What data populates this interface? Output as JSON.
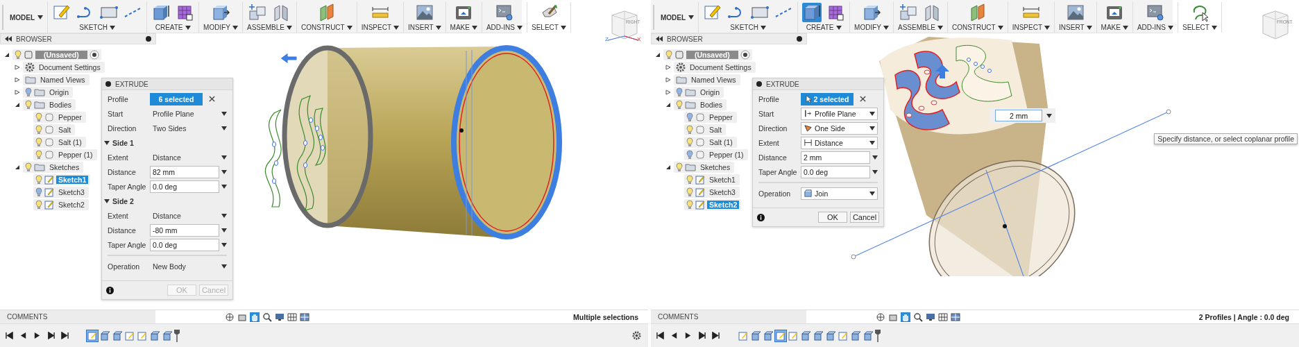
{
  "panes": [
    {
      "toolbar": {
        "workspace": "MODEL",
        "groups": [
          {
            "label": "SKETCH",
            "selected": false
          },
          {
            "label": "CREATE",
            "selected": false
          },
          {
            "label": "MODIFY",
            "selected": false
          },
          {
            "label": "ASSEMBLE",
            "selected": false
          },
          {
            "label": "CONSTRUCT",
            "selected": false
          },
          {
            "label": "INSPECT",
            "selected": false
          },
          {
            "label": "INSERT",
            "selected": false
          },
          {
            "label": "MAKE",
            "selected": false
          },
          {
            "label": "ADD-INS",
            "selected": false
          },
          {
            "label": "SELECT",
            "selected": false
          }
        ]
      },
      "view_cube": {
        "face": "RIGHT",
        "axes": [
          "Z",
          "X"
        ]
      },
      "browser": {
        "title": "BROWSER",
        "tree": [
          {
            "label": "(Unsaved)",
            "kind": "component",
            "expanded": true,
            "visible": true,
            "selected": false,
            "children": [
              {
                "label": "Document Settings",
                "kind": "settings",
                "expanded": false,
                "selected": false
              },
              {
                "label": "Named Views",
                "kind": "folder",
                "expanded": false,
                "selected": false
              },
              {
                "label": "Origin",
                "kind": "folder",
                "expanded": false,
                "visible": false,
                "selected": false
              },
              {
                "label": "Bodies",
                "kind": "folder",
                "expanded": true,
                "visible": true,
                "selected": false,
                "children": [
                  {
                    "label": "Pepper",
                    "kind": "body",
                    "visible": true,
                    "selected": false
                  },
                  {
                    "label": "Salt",
                    "kind": "body",
                    "visible": true,
                    "selected": false
                  },
                  {
                    "label": "Salt (1)",
                    "kind": "body",
                    "visible": true,
                    "selected": false
                  },
                  {
                    "label": "Pepper (1)",
                    "kind": "body",
                    "visible": true,
                    "selected": false
                  }
                ]
              },
              {
                "label": "Sketches",
                "kind": "folder",
                "expanded": true,
                "visible": true,
                "selected": false,
                "children": [
                  {
                    "label": "Sketch1",
                    "kind": "sketch",
                    "visible": true,
                    "selected": true
                  },
                  {
                    "label": "Sketch3",
                    "kind": "sketch",
                    "visible": false,
                    "selected": false
                  },
                  {
                    "label": "Sketch2",
                    "kind": "sketch",
                    "visible": true,
                    "selected": false
                  }
                ]
              }
            ]
          }
        ]
      },
      "dialog": {
        "title": "EXTRUDE",
        "rows": [
          {
            "kind": "selection",
            "label": "Profile",
            "value": "6 selected",
            "picking": false
          },
          {
            "kind": "menu",
            "label": "Start",
            "value": "Profile Plane"
          },
          {
            "kind": "menu",
            "label": "Direction",
            "value": "Two Sides"
          },
          {
            "kind": "section",
            "label": "Side 1",
            "expanded": true
          },
          {
            "kind": "menu",
            "label": "Extent",
            "value": "Distance"
          },
          {
            "kind": "field",
            "label": "Distance",
            "value": "82 mm"
          },
          {
            "kind": "field",
            "label": "Taper Angle",
            "value": "0.0 deg"
          },
          {
            "kind": "section",
            "label": "Side 2",
            "expanded": true
          },
          {
            "kind": "menu",
            "label": "Extent",
            "value": "Distance"
          },
          {
            "kind": "field",
            "label": "Distance",
            "value": "-80 mm"
          },
          {
            "kind": "field",
            "label": "Taper Angle",
            "value": "0.0 deg"
          },
          {
            "kind": "divider"
          },
          {
            "kind": "menu",
            "label": "Operation",
            "value": "New Body"
          }
        ],
        "buttons": [
          {
            "label": "OK",
            "disabled": true
          },
          {
            "label": "Cancel",
            "disabled": true
          }
        ]
      },
      "comments": {
        "title": "COMMENTS"
      },
      "status": "Multiple selections",
      "timeline": [
        {
          "kind": "sketch",
          "selected": true
        },
        {
          "kind": "extrude",
          "selected": false
        },
        {
          "kind": "extrude",
          "selected": false
        },
        {
          "kind": "sketch",
          "selected": false
        },
        {
          "kind": "sketch",
          "selected": false
        },
        {
          "kind": "extrude",
          "selected": false
        },
        {
          "kind": "extrude",
          "selected": false
        }
      ]
    },
    {
      "toolbar": {
        "workspace": "MODEL",
        "groups": [
          {
            "label": "SKETCH",
            "selected": false
          },
          {
            "label": "CREATE",
            "selected": true
          },
          {
            "label": "MODIFY",
            "selected": false
          },
          {
            "label": "ASSEMBLE",
            "selected": false
          },
          {
            "label": "CONSTRUCT",
            "selected": false
          },
          {
            "label": "INSPECT",
            "selected": false
          },
          {
            "label": "INSERT",
            "selected": false
          },
          {
            "label": "MAKE",
            "selected": false
          },
          {
            "label": "ADD-INS",
            "selected": false
          },
          {
            "label": "SELECT",
            "selected": false
          }
        ]
      },
      "view_cube": {
        "face": "FRONT"
      },
      "browser": {
        "title": "BROWSER",
        "tree": [
          {
            "label": "(Unsaved)",
            "kind": "component",
            "expanded": true,
            "visible": true,
            "selected": false,
            "children": [
              {
                "label": "Document Settings",
                "kind": "settings",
                "expanded": false,
                "selected": false
              },
              {
                "label": "Named Views",
                "kind": "folder",
                "expanded": false,
                "selected": false
              },
              {
                "label": "Origin",
                "kind": "folder",
                "expanded": false,
                "visible": false,
                "selected": false
              },
              {
                "label": "Bodies",
                "kind": "folder",
                "expanded": true,
                "visible": true,
                "selected": false,
                "children": [
                  {
                    "label": "Pepper",
                    "kind": "body",
                    "visible": false,
                    "selected": false
                  },
                  {
                    "label": "Salt",
                    "kind": "body",
                    "visible": true,
                    "selected": false
                  },
                  {
                    "label": "Salt (1)",
                    "kind": "body",
                    "visible": true,
                    "selected": false
                  },
                  {
                    "label": "Pepper (1)",
                    "kind": "body",
                    "visible": false,
                    "selected": false
                  }
                ]
              },
              {
                "label": "Sketches",
                "kind": "folder",
                "expanded": true,
                "visible": true,
                "selected": false,
                "children": [
                  {
                    "label": "Sketch1",
                    "kind": "sketch",
                    "visible": true,
                    "selected": false
                  },
                  {
                    "label": "Sketch3",
                    "kind": "sketch",
                    "visible": true,
                    "selected": false
                  },
                  {
                    "label": "Sketch2",
                    "kind": "sketch",
                    "visible": true,
                    "selected": true
                  }
                ]
              }
            ]
          }
        ]
      },
      "dialog": {
        "title": "EXTRUDE",
        "rows": [
          {
            "kind": "selection",
            "label": "Profile",
            "value": "2 selected",
            "picking": true
          },
          {
            "kind": "select",
            "label": "Start",
            "value": "Profile Plane"
          },
          {
            "kind": "select",
            "label": "Direction",
            "value": "One Side"
          },
          {
            "kind": "select",
            "label": "Extent",
            "value": "Distance"
          },
          {
            "kind": "field",
            "label": "Distance",
            "value": "2 mm"
          },
          {
            "kind": "field",
            "label": "Taper Angle",
            "value": "0.0 deg"
          },
          {
            "kind": "divider"
          },
          {
            "kind": "select",
            "label": "Operation",
            "value": "Join"
          }
        ],
        "buttons": [
          {
            "label": "OK",
            "disabled": false
          },
          {
            "label": "Cancel",
            "disabled": false
          }
        ]
      },
      "viewport": {
        "distance_input": "2 mm",
        "tooltip": "Specify distance, or select coplanar profile"
      },
      "comments": {
        "title": "COMMENTS"
      },
      "status": "2 Profiles | Angle : 0.0 deg",
      "timeline": [
        {
          "kind": "sketch",
          "selected": false
        },
        {
          "kind": "extrude",
          "selected": false
        },
        {
          "kind": "extrude",
          "selected": false
        },
        {
          "kind": "sketch",
          "selected": true
        },
        {
          "kind": "sketch",
          "selected": false
        },
        {
          "kind": "extrude",
          "selected": false
        },
        {
          "kind": "extrude",
          "selected": false
        },
        {
          "kind": "extrude",
          "selected": false
        },
        {
          "kind": "sketch",
          "selected": false
        },
        {
          "kind": "extrude",
          "selected": false
        },
        {
          "kind": "extrude",
          "selected": false
        }
      ]
    }
  ]
}
